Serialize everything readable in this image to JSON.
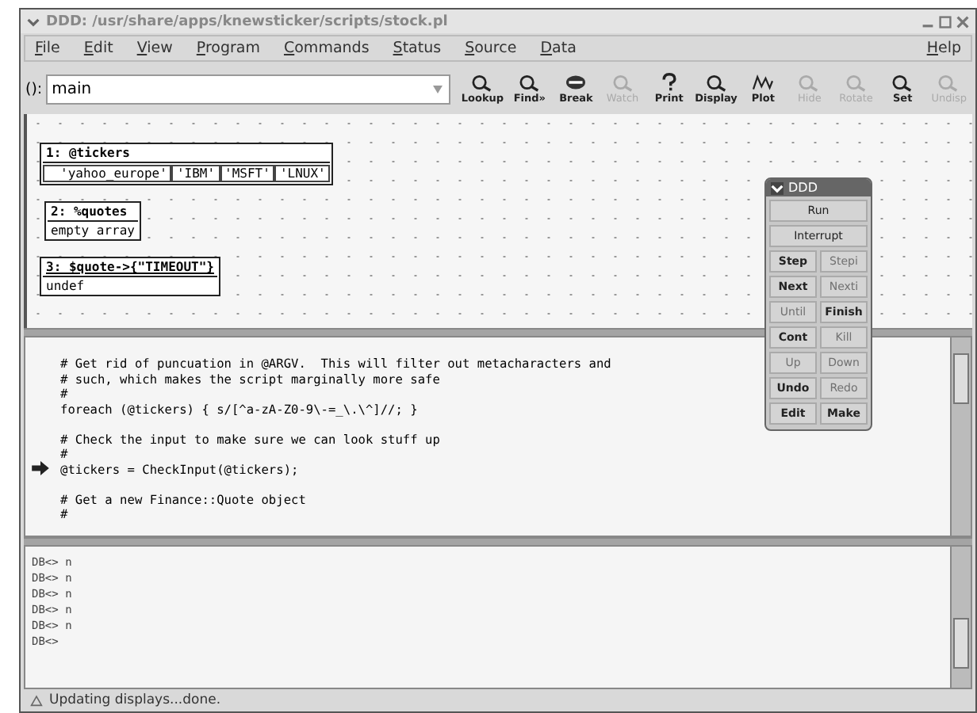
{
  "window": {
    "title": "DDD: /usr/share/apps/knewsticker/scripts/stock.pl"
  },
  "menu": [
    "File",
    "Edit",
    "View",
    "Program",
    "Commands",
    "Status",
    "Source",
    "Data"
  ],
  "help_menu": "Help",
  "argument": {
    "label": "():",
    "value": "main"
  },
  "toolbar": [
    {
      "label": "Lookup",
      "disabled": false
    },
    {
      "label": "Find»",
      "disabled": false
    },
    {
      "label": "Break",
      "disabled": false
    },
    {
      "label": "Watch",
      "disabled": true
    },
    {
      "label": "Print",
      "disabled": false
    },
    {
      "label": "Display",
      "disabled": false
    },
    {
      "label": "Plot",
      "disabled": false
    },
    {
      "label": "Hide",
      "disabled": true
    },
    {
      "label": "Rotate",
      "disabled": true
    },
    {
      "label": "Set",
      "disabled": false
    },
    {
      "label": "Undisp",
      "disabled": true
    }
  ],
  "displays": [
    {
      "title": "1: @tickers",
      "values": [
        "'yahoo_europe'",
        "'IBM'",
        "'MSFT'",
        "'LNUX'"
      ],
      "selected": false
    },
    {
      "title": "2: %quotes",
      "values": [
        "empty array"
      ],
      "selected": false
    },
    {
      "title": "3: $quote->{\"TIMEOUT\"}",
      "values": [
        "undef"
      ],
      "selected": true
    }
  ],
  "command_tool": {
    "title": "DDD",
    "buttons": [
      {
        "label": "Run",
        "disabled": false
      },
      {
        "label": "Interrupt",
        "disabled": false
      },
      {
        "label": "Step",
        "disabled": false
      },
      {
        "label": "Stepi",
        "disabled": true
      },
      {
        "label": "Next",
        "disabled": false
      },
      {
        "label": "Nexti",
        "disabled": true
      },
      {
        "label": "Until",
        "disabled": true
      },
      {
        "label": "Finish",
        "disabled": false
      },
      {
        "label": "Cont",
        "disabled": false
      },
      {
        "label": "Kill",
        "disabled": true
      },
      {
        "label": "Up",
        "disabled": true
      },
      {
        "label": "Down",
        "disabled": true
      },
      {
        "label": "Undo",
        "disabled": false
      },
      {
        "label": "Redo",
        "disabled": true
      },
      {
        "label": "Edit",
        "disabled": false
      },
      {
        "label": "Make",
        "disabled": false
      }
    ]
  },
  "source": [
    {
      "text": "# Get rid of puncuation in @ARGV.  This will filter out metacharacters and",
      "current": false
    },
    {
      "text": "# such, which makes the script marginally more safe",
      "current": false
    },
    {
      "text": "#",
      "current": false
    },
    {
      "text": "foreach (@tickers) { s/[^a-zA-Z0-9\\-=_\\.\\^]//; }",
      "current": false
    },
    {
      "current": false
    },
    {
      "text": "# Check the input to make sure we can look stuff up",
      "current": false
    },
    {
      "text": "#",
      "current": false
    },
    {
      "text": "@tickers = CheckInput(@tickers);",
      "current": true
    },
    {
      "current": false
    },
    {
      "text": "# Get a new Finance::Quote object",
      "current": false
    },
    {
      "text": "#",
      "current": false
    }
  ],
  "console": [
    "DB<> n",
    "DB<> n",
    "DB<> n",
    "DB<> n",
    "DB<> n",
    "DB<>"
  ],
  "status_bar": "Updating displays...done."
}
